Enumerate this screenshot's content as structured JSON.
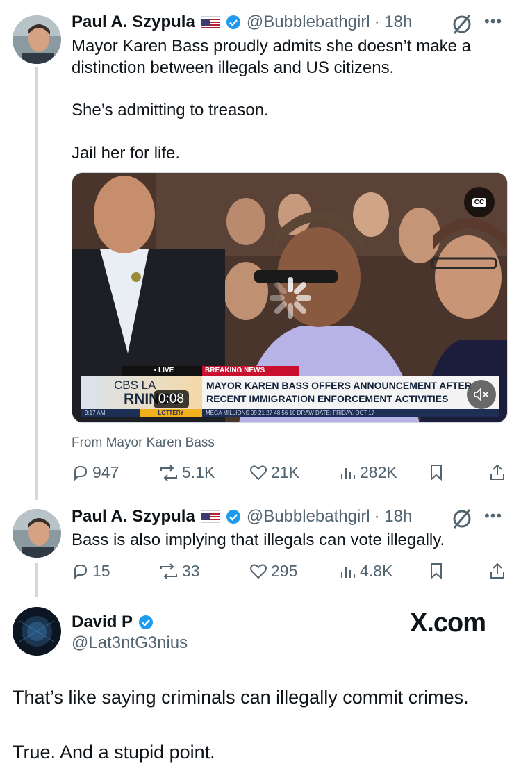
{
  "post1": {
    "name": "Paul A. Szypula",
    "handle": "@Bubblebathgirl",
    "time": "· 18h",
    "text_lines": [
      "Mayor Karen Bass proudly admits she doesn’t make a",
      "distinction between illegals and US citizens."
    ],
    "text_p2": "She’s admitting to treason.",
    "text_p3": "Jail her for life.",
    "video": {
      "timestamp": "0:08",
      "cc_label": "CC",
      "live_tag": "• LIVE",
      "breaking_tag": "BREAKING NEWS",
      "logo_line1": "CBS LA",
      "logo_line2": "RNINGS",
      "headline_line1": "MAYOR KAREN BASS OFFERS ANNOUNCEMENT AFTER",
      "headline_line2": "RECENT IMMIGRATION ENFORCEMENT ACTIVITIES",
      "strip_time": "9:17 AM",
      "strip_lottery": "LOTTERY",
      "strip_mega": "MEGA MILLIONS   09 21 27 48 56 10   DRAW DATE: FRIDAY, OCT 17"
    },
    "source": "From Mayor Karen Bass",
    "stats": {
      "replies": "947",
      "reposts": "5.1K",
      "likes": "21K",
      "views": "282K"
    }
  },
  "post2": {
    "name": "Paul A. Szypula",
    "handle": "@Bubblebathgirl",
    "time": "· 18h",
    "text": "Bass is also implying that illegals can vote illegally.",
    "stats": {
      "replies": "15",
      "reposts": "33",
      "likes": "295",
      "views": "4.8K"
    }
  },
  "post3": {
    "name": "David P",
    "handle": "@Lat3ntG3nius",
    "text_p1": "That’s like saying criminals can illegally commit crimes.",
    "text_p2": "True. And a stupid point."
  },
  "watermark": "X.com",
  "icons": [
    "verified-badge-icon",
    "us-flag-icon",
    "grok-icon",
    "more-icon",
    "reply-icon",
    "repost-icon",
    "like-icon",
    "views-icon",
    "bookmark-icon",
    "share-icon",
    "mute-icon",
    "loading-spinner-icon"
  ],
  "colors": {
    "verified": "#1d9bf0",
    "muted_text": "#536471",
    "text": "#0f1419",
    "thread_line": "#cfd9de"
  }
}
